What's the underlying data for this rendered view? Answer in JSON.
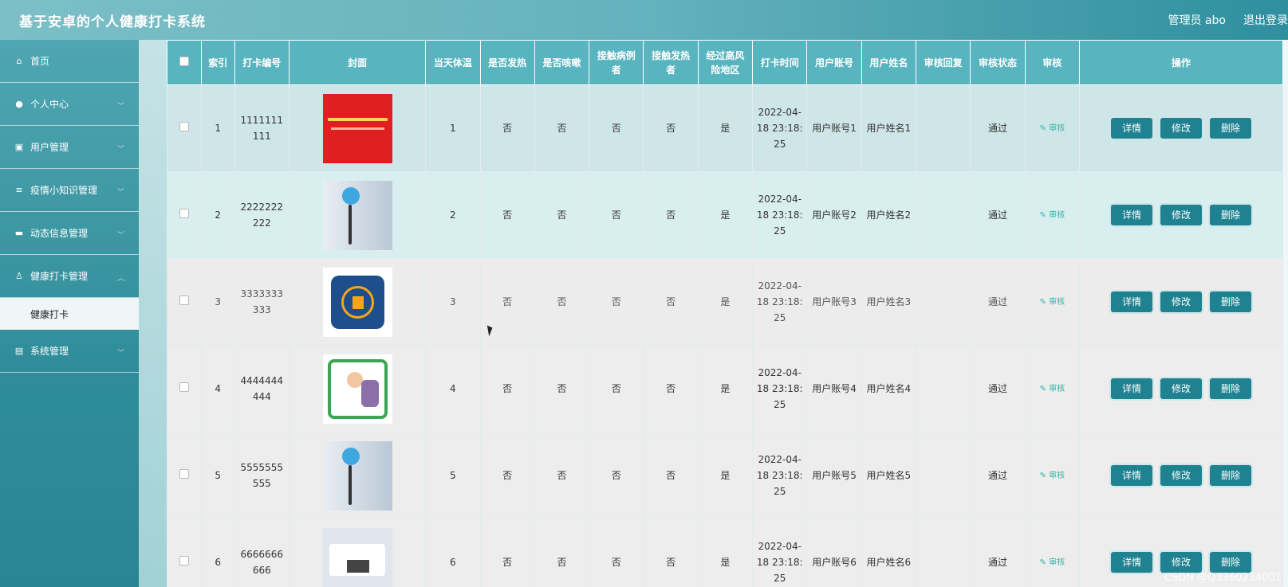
{
  "app": {
    "title": "基于安卓的个人健康打卡系统",
    "user_label": "管理员 abo",
    "logout_label": "退出登录"
  },
  "sidebar": {
    "items": [
      {
        "label": "首页",
        "icon": "home-icon"
      },
      {
        "label": "个人中心",
        "icon": "user-icon"
      },
      {
        "label": "用户管理",
        "icon": "clipboard-icon"
      },
      {
        "label": "疫情小知识管理",
        "icon": "list-icon"
      },
      {
        "label": "动态信息管理",
        "icon": "comment-icon"
      },
      {
        "label": "健康打卡管理",
        "icon": "person-icon"
      }
    ],
    "sub_item": "健康打卡",
    "last_item": {
      "label": "系统管理",
      "icon": "chart-icon"
    }
  },
  "table": {
    "headers": [
      "索引",
      "打卡编号",
      "封面",
      "当天体温",
      "是否发热",
      "是否咳嗽",
      "接触病例者",
      "接触发热者",
      "经过高风险地区",
      "打卡时间",
      "用户账号",
      "用户姓名",
      "审核回复",
      "审核状态",
      "审核",
      "操作"
    ],
    "rows": [
      {
        "index": "1",
        "code": "1111111111",
        "temp": "1",
        "fever": "否",
        "cough": "否",
        "contact_case": "否",
        "contact_fever": "否",
        "risk": "是",
        "time": "2022-04-18 23:18:25",
        "account": "用户账号1",
        "name": "用户姓名1",
        "reply": "",
        "status": "通过",
        "audit": "审核"
      },
      {
        "index": "2",
        "code": "2222222222",
        "temp": "2",
        "fever": "否",
        "cough": "否",
        "contact_case": "否",
        "contact_fever": "否",
        "risk": "是",
        "time": "2022-04-18 23:18:25",
        "account": "用户账号2",
        "name": "用户姓名2",
        "reply": "",
        "status": "通过",
        "audit": "审核"
      },
      {
        "index": "3",
        "code": "3333333333",
        "temp": "3",
        "fever": "否",
        "cough": "否",
        "contact_case": "否",
        "contact_fever": "否",
        "risk": "是",
        "time": "2022-04-18 23:18:25",
        "account": "用户账号3",
        "name": "用户姓名3",
        "reply": "",
        "status": "通过",
        "audit": "审核"
      },
      {
        "index": "4",
        "code": "4444444444",
        "temp": "4",
        "fever": "否",
        "cough": "否",
        "contact_case": "否",
        "contact_fever": "否",
        "risk": "是",
        "time": "2022-04-18 23:18:25",
        "account": "用户账号4",
        "name": "用户姓名4",
        "reply": "",
        "status": "通过",
        "audit": "审核"
      },
      {
        "index": "5",
        "code": "5555555555",
        "temp": "5",
        "fever": "否",
        "cough": "否",
        "contact_case": "否",
        "contact_fever": "否",
        "risk": "是",
        "time": "2022-04-18 23:18:25",
        "account": "用户账号5",
        "name": "用户姓名5",
        "reply": "",
        "status": "通过",
        "audit": "审核"
      },
      {
        "index": "6",
        "code": "6666666666",
        "temp": "6",
        "fever": "否",
        "cough": "否",
        "contact_case": "否",
        "contact_fever": "否",
        "risk": "是",
        "time": "2022-04-18 23:18:25",
        "account": "用户账号6",
        "name": "用户姓名6",
        "reply": "",
        "status": "通过",
        "audit": "审核"
      }
    ],
    "actions": {
      "detail": "详情",
      "edit": "修改",
      "delete": "删除"
    }
  },
  "watermark": "CSDN @Q3360234001",
  "colors": {
    "header_bg": "#58b4bf",
    "button": "#1f8290",
    "accent": "#31b3a6"
  }
}
